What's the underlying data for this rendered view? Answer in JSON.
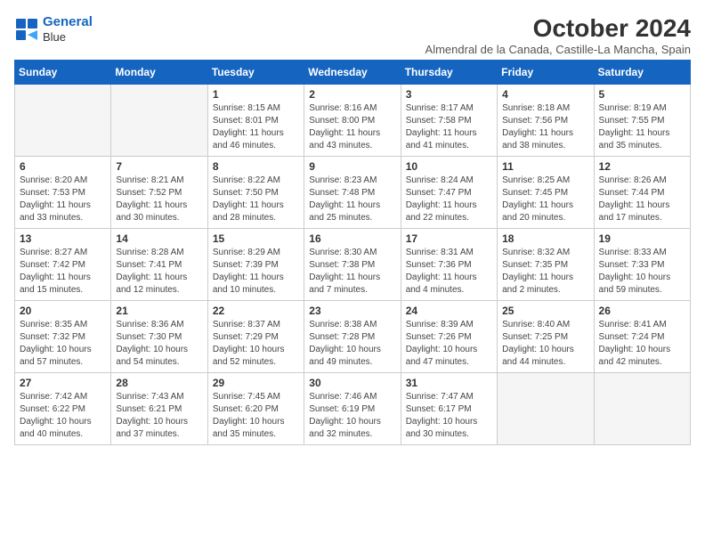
{
  "header": {
    "logo_line1": "General",
    "logo_line2": "Blue",
    "month": "October 2024",
    "location": "Almendral de la Canada, Castille-La Mancha, Spain"
  },
  "weekdays": [
    "Sunday",
    "Monday",
    "Tuesday",
    "Wednesday",
    "Thursday",
    "Friday",
    "Saturday"
  ],
  "weeks": [
    [
      {
        "day": "",
        "info": ""
      },
      {
        "day": "",
        "info": ""
      },
      {
        "day": "1",
        "info": "Sunrise: 8:15 AM\nSunset: 8:01 PM\nDaylight: 11 hours and 46 minutes."
      },
      {
        "day": "2",
        "info": "Sunrise: 8:16 AM\nSunset: 8:00 PM\nDaylight: 11 hours and 43 minutes."
      },
      {
        "day": "3",
        "info": "Sunrise: 8:17 AM\nSunset: 7:58 PM\nDaylight: 11 hours and 41 minutes."
      },
      {
        "day": "4",
        "info": "Sunrise: 8:18 AM\nSunset: 7:56 PM\nDaylight: 11 hours and 38 minutes."
      },
      {
        "day": "5",
        "info": "Sunrise: 8:19 AM\nSunset: 7:55 PM\nDaylight: 11 hours and 35 minutes."
      }
    ],
    [
      {
        "day": "6",
        "info": "Sunrise: 8:20 AM\nSunset: 7:53 PM\nDaylight: 11 hours and 33 minutes."
      },
      {
        "day": "7",
        "info": "Sunrise: 8:21 AM\nSunset: 7:52 PM\nDaylight: 11 hours and 30 minutes."
      },
      {
        "day": "8",
        "info": "Sunrise: 8:22 AM\nSunset: 7:50 PM\nDaylight: 11 hours and 28 minutes."
      },
      {
        "day": "9",
        "info": "Sunrise: 8:23 AM\nSunset: 7:48 PM\nDaylight: 11 hours and 25 minutes."
      },
      {
        "day": "10",
        "info": "Sunrise: 8:24 AM\nSunset: 7:47 PM\nDaylight: 11 hours and 22 minutes."
      },
      {
        "day": "11",
        "info": "Sunrise: 8:25 AM\nSunset: 7:45 PM\nDaylight: 11 hours and 20 minutes."
      },
      {
        "day": "12",
        "info": "Sunrise: 8:26 AM\nSunset: 7:44 PM\nDaylight: 11 hours and 17 minutes."
      }
    ],
    [
      {
        "day": "13",
        "info": "Sunrise: 8:27 AM\nSunset: 7:42 PM\nDaylight: 11 hours and 15 minutes."
      },
      {
        "day": "14",
        "info": "Sunrise: 8:28 AM\nSunset: 7:41 PM\nDaylight: 11 hours and 12 minutes."
      },
      {
        "day": "15",
        "info": "Sunrise: 8:29 AM\nSunset: 7:39 PM\nDaylight: 11 hours and 10 minutes."
      },
      {
        "day": "16",
        "info": "Sunrise: 8:30 AM\nSunset: 7:38 PM\nDaylight: 11 hours and 7 minutes."
      },
      {
        "day": "17",
        "info": "Sunrise: 8:31 AM\nSunset: 7:36 PM\nDaylight: 11 hours and 4 minutes."
      },
      {
        "day": "18",
        "info": "Sunrise: 8:32 AM\nSunset: 7:35 PM\nDaylight: 11 hours and 2 minutes."
      },
      {
        "day": "19",
        "info": "Sunrise: 8:33 AM\nSunset: 7:33 PM\nDaylight: 10 hours and 59 minutes."
      }
    ],
    [
      {
        "day": "20",
        "info": "Sunrise: 8:35 AM\nSunset: 7:32 PM\nDaylight: 10 hours and 57 minutes."
      },
      {
        "day": "21",
        "info": "Sunrise: 8:36 AM\nSunset: 7:30 PM\nDaylight: 10 hours and 54 minutes."
      },
      {
        "day": "22",
        "info": "Sunrise: 8:37 AM\nSunset: 7:29 PM\nDaylight: 10 hours and 52 minutes."
      },
      {
        "day": "23",
        "info": "Sunrise: 8:38 AM\nSunset: 7:28 PM\nDaylight: 10 hours and 49 minutes."
      },
      {
        "day": "24",
        "info": "Sunrise: 8:39 AM\nSunset: 7:26 PM\nDaylight: 10 hours and 47 minutes."
      },
      {
        "day": "25",
        "info": "Sunrise: 8:40 AM\nSunset: 7:25 PM\nDaylight: 10 hours and 44 minutes."
      },
      {
        "day": "26",
        "info": "Sunrise: 8:41 AM\nSunset: 7:24 PM\nDaylight: 10 hours and 42 minutes."
      }
    ],
    [
      {
        "day": "27",
        "info": "Sunrise: 7:42 AM\nSunset: 6:22 PM\nDaylight: 10 hours and 40 minutes."
      },
      {
        "day": "28",
        "info": "Sunrise: 7:43 AM\nSunset: 6:21 PM\nDaylight: 10 hours and 37 minutes."
      },
      {
        "day": "29",
        "info": "Sunrise: 7:45 AM\nSunset: 6:20 PM\nDaylight: 10 hours and 35 minutes."
      },
      {
        "day": "30",
        "info": "Sunrise: 7:46 AM\nSunset: 6:19 PM\nDaylight: 10 hours and 32 minutes."
      },
      {
        "day": "31",
        "info": "Sunrise: 7:47 AM\nSunset: 6:17 PM\nDaylight: 10 hours and 30 minutes."
      },
      {
        "day": "",
        "info": ""
      },
      {
        "day": "",
        "info": ""
      }
    ]
  ]
}
